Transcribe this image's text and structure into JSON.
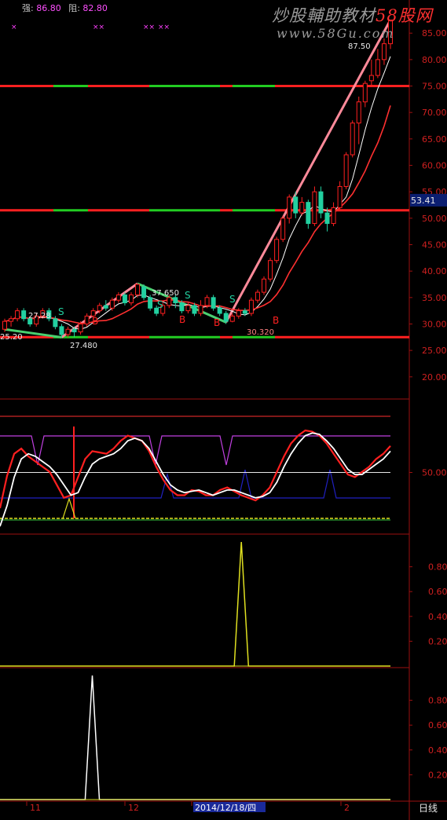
{
  "header": {
    "strong_label": "强",
    "strong_value": "86.80",
    "resist_label": "阻",
    "resist_value": "82.80"
  },
  "watermark": {
    "line1_a": "炒股輔助教材",
    "line1_b": "58股网",
    "line2": "www.58Gu.com"
  },
  "markers": {
    "x_marks": [
      "×",
      "××",
      "××",
      "××"
    ]
  },
  "period_label": "日线",
  "colors": {
    "background": "#000000",
    "axis": "#9b1010",
    "up": "#ff2020",
    "down": "#22d0a0",
    "green_line": "#22cc22",
    "magenta": "#c040e0",
    "navy": "#2020c0",
    "yellow": "#e0e020"
  },
  "chart_data": [
    {
      "type": "candlestick",
      "panel": "price",
      "y_ticks": [
        20,
        25,
        30,
        35,
        40,
        45,
        50,
        55,
        60,
        65,
        70,
        75,
        80,
        85
      ],
      "ylim": [
        17,
        88
      ],
      "current_price_label": "53.41",
      "high_label": "87.50",
      "support_resistance_levels": [
        75,
        51.5,
        27.5
      ],
      "annotations": [
        "37.650",
        "27.480",
        "30.320",
        "27.28",
        "25.20"
      ],
      "signal_letters": [
        "S",
        "B"
      ],
      "candles": [
        [
          29,
          30.5,
          28.5,
          31
        ],
        [
          30.5,
          31,
          29.5,
          31.5
        ],
        [
          31,
          32.5,
          30.5,
          33
        ],
        [
          32.5,
          31,
          30.5,
          33
        ],
        [
          31,
          30,
          29.5,
          31.5
        ],
        [
          30,
          31.5,
          29.5,
          32
        ],
        [
          31.5,
          32.5,
          31,
          33
        ],
        [
          32.5,
          31,
          30.5,
          33
        ],
        [
          31,
          29.5,
          29,
          31.5
        ],
        [
          29.5,
          28,
          27.5,
          30
        ],
        [
          28,
          29,
          27.5,
          29.5
        ],
        [
          29,
          28.5,
          27.5,
          29.5
        ],
        [
          28.5,
          30,
          28,
          30.5
        ],
        [
          30,
          31.5,
          29.5,
          32
        ],
        [
          31.5,
          32.5,
          31,
          33
        ],
        [
          32.5,
          33.5,
          32,
          34
        ],
        [
          33.5,
          33,
          32.5,
          34.5
        ],
        [
          33,
          34.5,
          32.5,
          35
        ],
        [
          34.5,
          35.5,
          34,
          36
        ],
        [
          35.5,
          34,
          33.5,
          36
        ],
        [
          34,
          35.5,
          33.5,
          36
        ],
        [
          35.5,
          37.5,
          35,
          37.65
        ],
        [
          37,
          35,
          34.5,
          37.5
        ],
        [
          35,
          33,
          32.5,
          35.5
        ],
        [
          33,
          32,
          31.5,
          33.5
        ],
        [
          32,
          33.5,
          31.5,
          34
        ],
        [
          33.5,
          35,
          33,
          35.5
        ],
        [
          35,
          34,
          33,
          35.5
        ],
        [
          34,
          32.5,
          32,
          34.5
        ],
        [
          32.5,
          33.5,
          32,
          34
        ],
        [
          33.5,
          32,
          31.5,
          34
        ],
        [
          32,
          33.5,
          31.5,
          34.5
        ],
        [
          33.5,
          35,
          33,
          35.5
        ],
        [
          35,
          33,
          32.5,
          35.5
        ],
        [
          33,
          32,
          31.5,
          33.5
        ],
        [
          32,
          30.5,
          30,
          32.5
        ],
        [
          30.5,
          31.5,
          30.32,
          32
        ],
        [
          31.5,
          32.5,
          31,
          33
        ],
        [
          32.5,
          32,
          31.5,
          33
        ],
        [
          32,
          34.5,
          31.5,
          35
        ],
        [
          34.5,
          36,
          34,
          36.5
        ],
        [
          36,
          38.5,
          35.5,
          39
        ],
        [
          38.5,
          42,
          38,
          42.5
        ],
        [
          42,
          46,
          41.5,
          46.5
        ],
        [
          46,
          50,
          45.5,
          50.5
        ],
        [
          50,
          54,
          49,
          54.5
        ],
        [
          54,
          51,
          50,
          55
        ],
        [
          51,
          53,
          50.5,
          54
        ],
        [
          53,
          49,
          48,
          53.5
        ],
        [
          49,
          55,
          48.5,
          56
        ],
        [
          55,
          51,
          50,
          56
        ],
        [
          51,
          49,
          47.5,
          52
        ],
        [
          49,
          52,
          48.5,
          53
        ],
        [
          52,
          56,
          51.5,
          57
        ],
        [
          56,
          62,
          55.5,
          62.5
        ],
        [
          62,
          68,
          61.5,
          68.5
        ],
        [
          68,
          72,
          64,
          73
        ],
        [
          72,
          75.5,
          71,
          76
        ],
        [
          76,
          77,
          75,
          80
        ],
        [
          77,
          80,
          76.5,
          82
        ],
        [
          80,
          83,
          79,
          84
        ],
        [
          83,
          87.5,
          82,
          87.5
        ]
      ]
    },
    {
      "type": "line",
      "panel": "oscillator",
      "y_ticks": [
        50
      ],
      "ylim": [
        0,
        100
      ],
      "series": [
        {
          "values": [
            20,
            45,
            62,
            66,
            60,
            56,
            52,
            48,
            38,
            28,
            30,
            44,
            58,
            64,
            63,
            62,
            66,
            72,
            76,
            74,
            72,
            64,
            52,
            42,
            34,
            30,
            30,
            34,
            33,
            30,
            30,
            34,
            36,
            33,
            30,
            28,
            26,
            30,
            36,
            48,
            60,
            70,
            76,
            80,
            79,
            76,
            70,
            62,
            54,
            46,
            44,
            48,
            52,
            58,
            62,
            68
          ]
        },
        {
          "values": [
            6,
            22,
            44,
            58,
            62,
            60,
            56,
            52,
            46,
            38,
            30,
            32,
            44,
            54,
            58,
            60,
            62,
            66,
            72,
            74,
            72,
            66,
            56,
            46,
            38,
            34,
            32,
            33,
            34,
            32,
            30,
            32,
            34,
            34,
            32,
            30,
            28,
            29,
            32,
            40,
            52,
            62,
            70,
            76,
            78,
            77,
            72,
            66,
            58,
            50,
            46,
            46,
            50,
            54,
            58,
            64
          ]
        }
      ]
    },
    {
      "type": "line",
      "panel": "signal_1",
      "y_ticks": [
        0.2,
        0.4,
        0.6,
        0.8
      ],
      "ylim": [
        0,
        1
      ],
      "series": [
        {
          "values": [
            0,
            0,
            0,
            0,
            0,
            0,
            0,
            0,
            0,
            0,
            0,
            0,
            0,
            0,
            0,
            0,
            0,
            0,
            0,
            0,
            0,
            0,
            0,
            0,
            0,
            0,
            0,
            0,
            0,
            0,
            0,
            0,
            0,
            0,
            1,
            0,
            0,
            0,
            0,
            0,
            0,
            0,
            0,
            0,
            0,
            0,
            0,
            0,
            0,
            0,
            0,
            0,
            0,
            0,
            0,
            0
          ]
        }
      ]
    },
    {
      "type": "line",
      "panel": "signal_2",
      "y_ticks": [
        0.2,
        0.4,
        0.6,
        0.8
      ],
      "ylim": [
        0,
        1
      ],
      "series": [
        {
          "values": [
            0,
            0,
            0,
            0,
            0,
            0,
            0,
            0,
            0,
            0,
            0,
            0,
            0,
            1,
            0,
            0,
            0,
            0,
            0,
            0,
            0,
            0,
            0,
            0,
            0,
            0,
            0,
            0,
            0,
            0,
            0,
            0,
            0,
            0,
            0,
            0,
            0,
            0,
            0,
            0,
            0,
            0,
            0,
            0,
            0,
            0,
            0,
            0,
            0,
            0,
            0,
            0,
            0,
            0,
            0,
            0
          ]
        }
      ]
    },
    {
      "type": "axis",
      "panel": "time",
      "tick_labels": [
        "11",
        "12",
        "2014/12/18/四",
        "2"
      ]
    }
  ]
}
